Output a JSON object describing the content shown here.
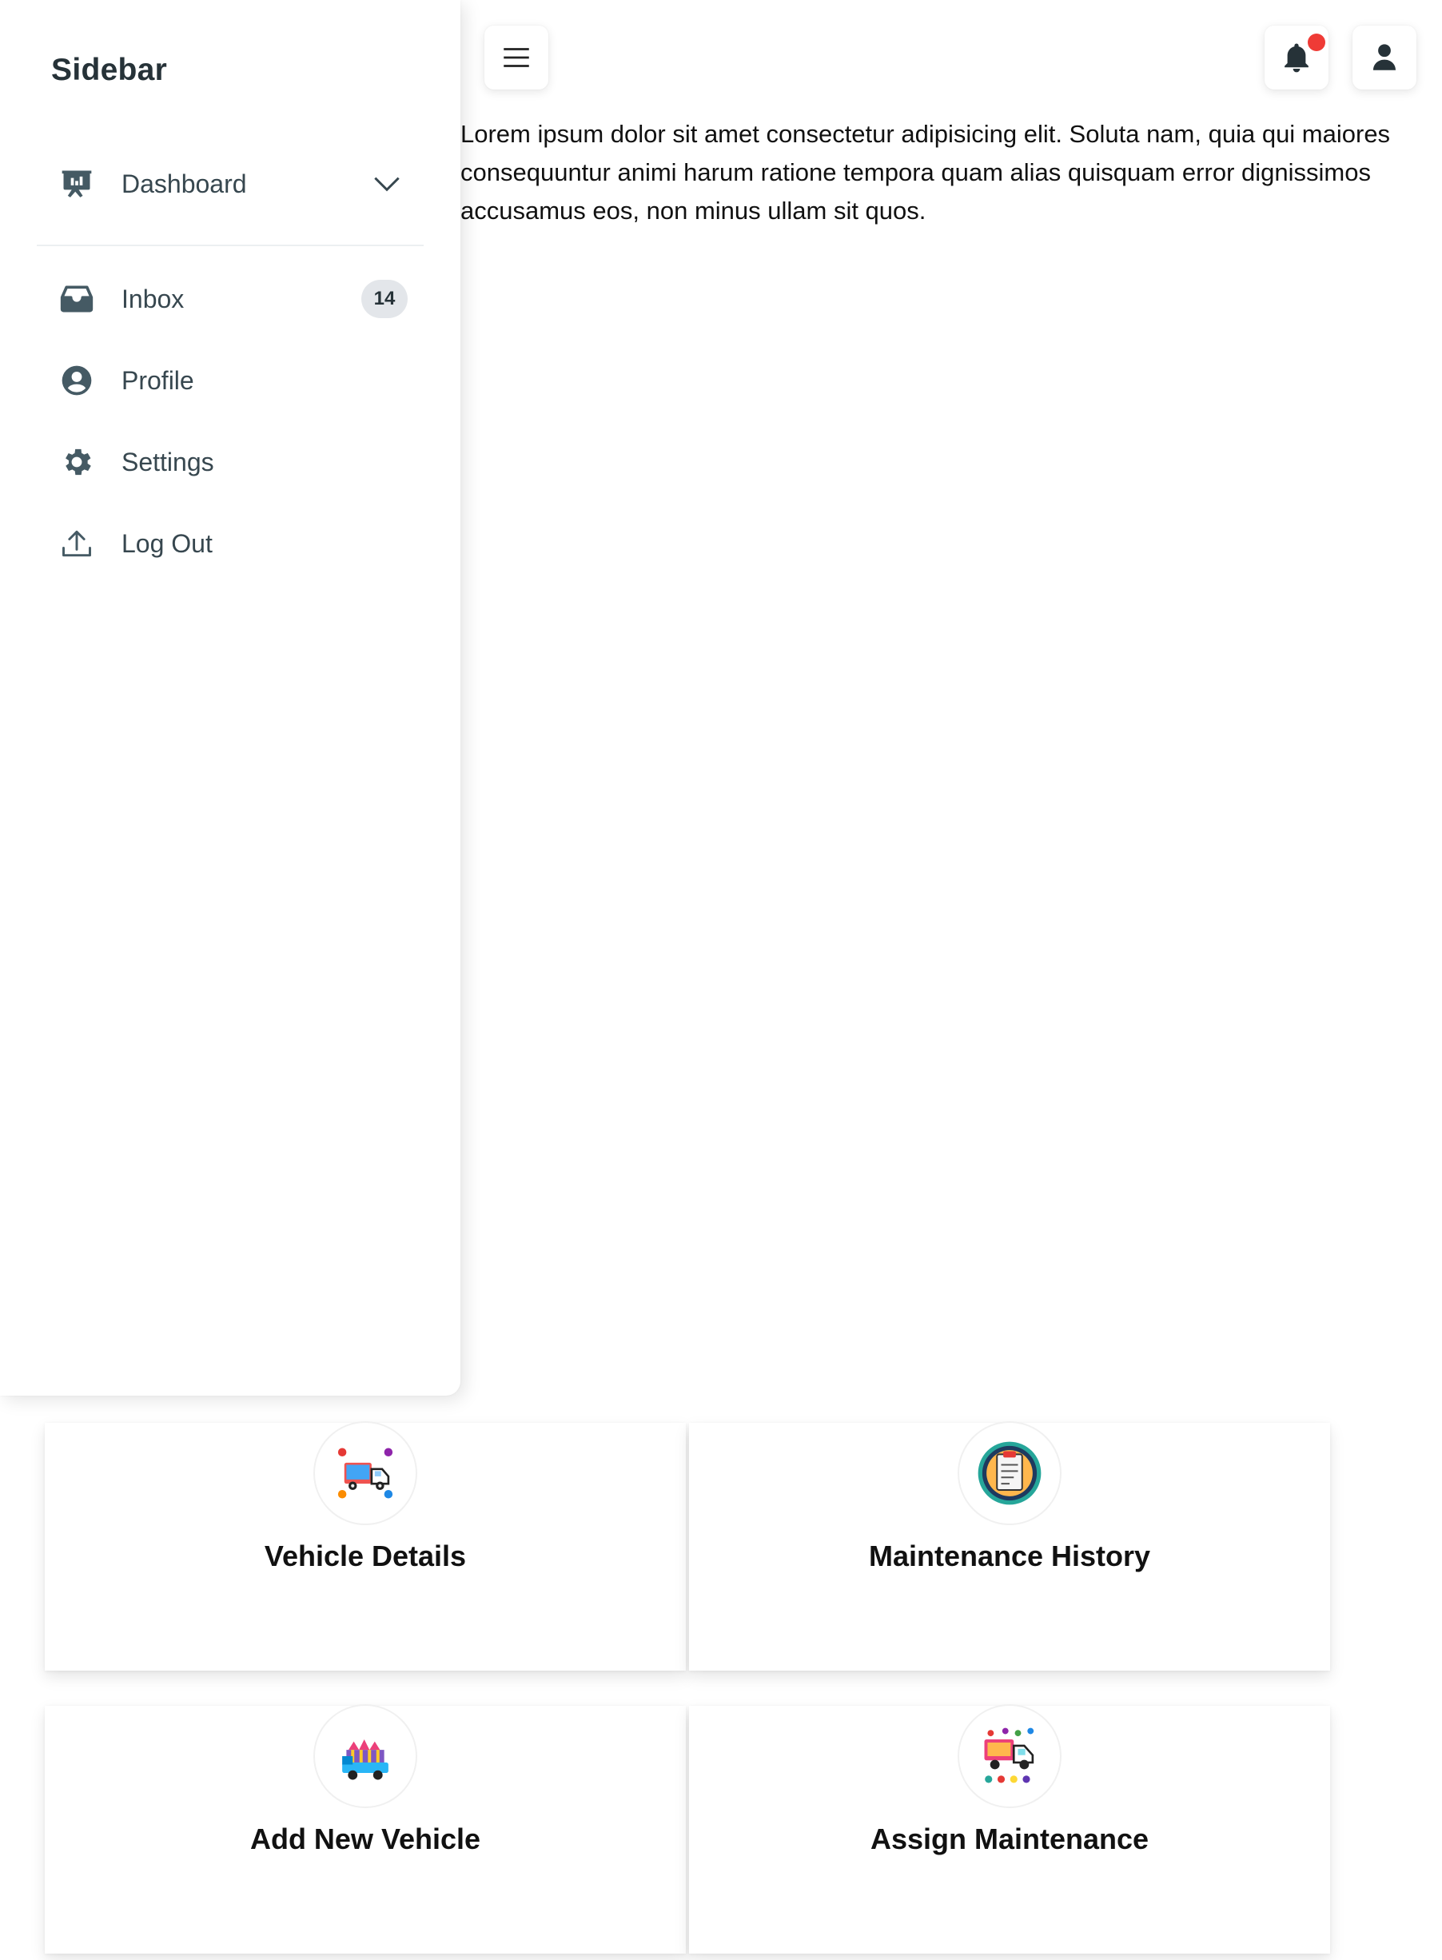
{
  "sidebar": {
    "title": "Sidebar",
    "items": [
      {
        "label": "Dashboard",
        "icon": "presentation-chart-icon",
        "expandable": true
      },
      {
        "label": "Inbox",
        "icon": "inbox-icon",
        "badge": "14"
      },
      {
        "label": "Profile",
        "icon": "user-circle-icon"
      },
      {
        "label": "Settings",
        "icon": "gear-icon"
      },
      {
        "label": "Log Out",
        "icon": "upload-icon"
      }
    ]
  },
  "header": {
    "menu_icon": "hamburger-menu-icon",
    "notification_icon": "bell-icon",
    "user_icon": "user-icon",
    "notification_dot_color": "#ef3b36"
  },
  "main": {
    "text": "Lorem ipsum dolor sit amet consectetur adipisicing elit. Soluta nam, quia qui maiores consequuntur animi harum ratione tempora quam alias quisquam error dignissimos accusamus eos, non minus ullam sit quos."
  },
  "cards": [
    {
      "title": "Vehicle Details",
      "icon": "truck-icon"
    },
    {
      "title": "Maintenance History",
      "icon": "clipboard-icon"
    },
    {
      "title": "Add New Vehicle",
      "icon": "truck-add-icon"
    },
    {
      "title": "Assign Maintenance",
      "icon": "truck-assign-icon"
    }
  ],
  "colors": {
    "sidebar_text": "#37474f",
    "badge_bg": "#e3e6ea"
  }
}
